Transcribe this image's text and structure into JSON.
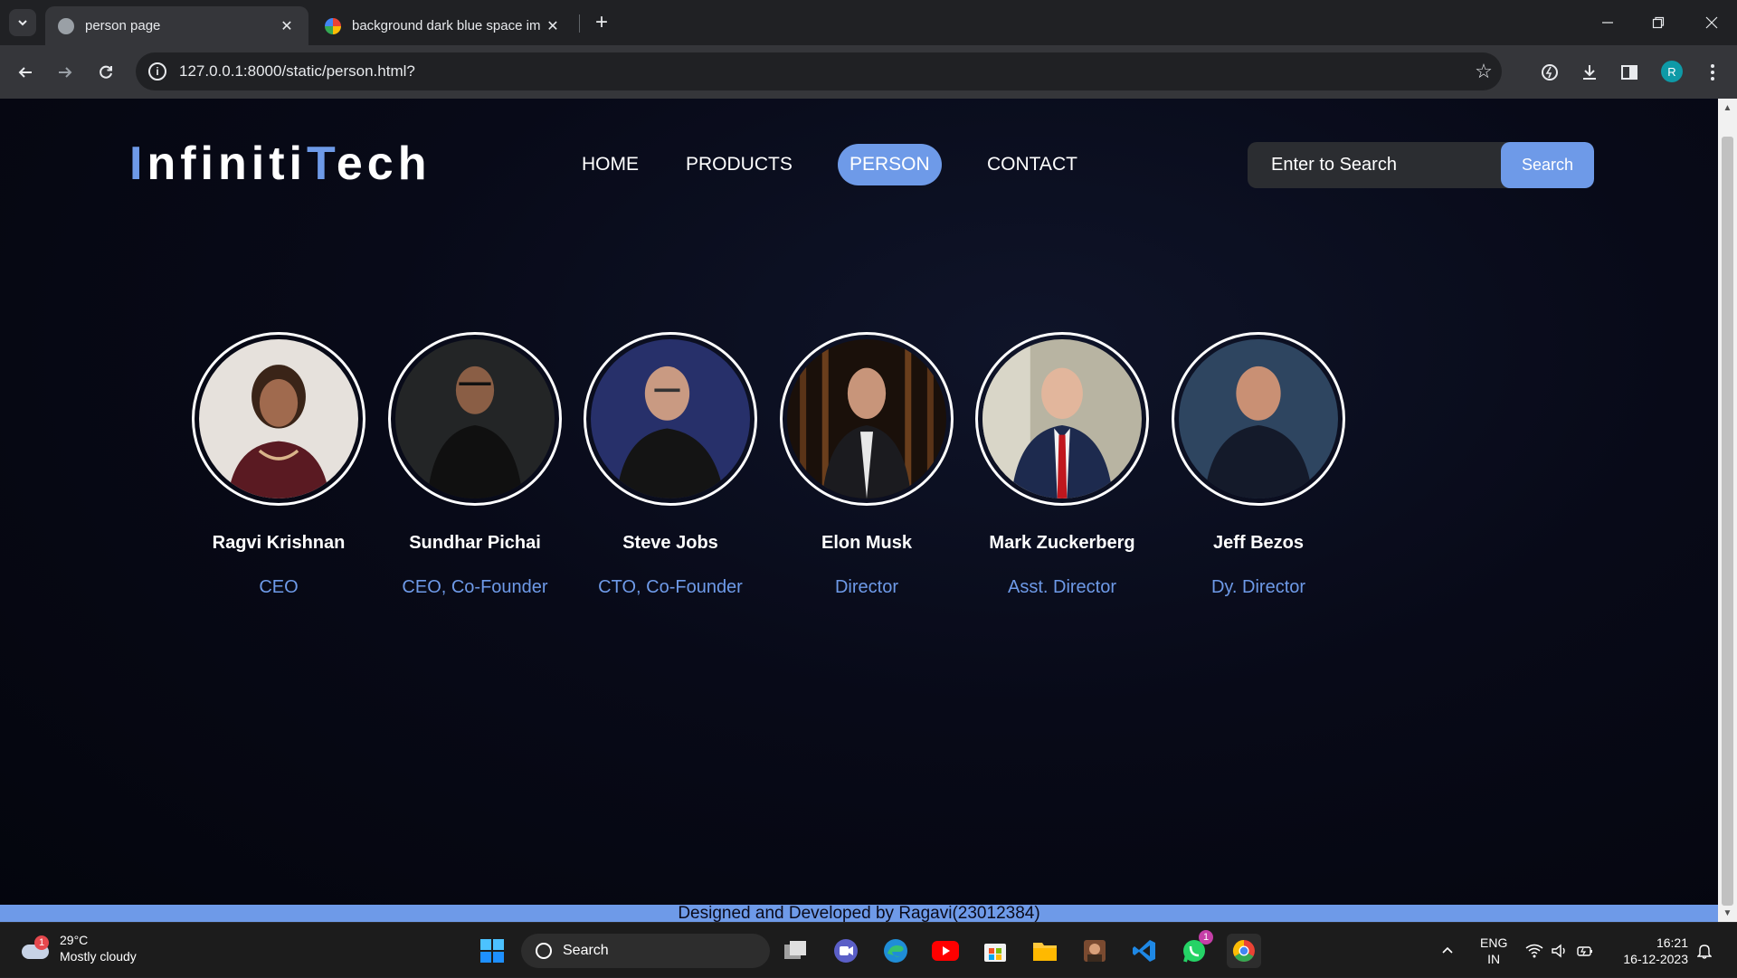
{
  "browser": {
    "tabs": [
      {
        "title": "person page",
        "active": true
      },
      {
        "title": "background dark blue space im",
        "active": false
      }
    ],
    "url": "127.0.0.1:8000/static/person.html?",
    "profile_initial": "R"
  },
  "site": {
    "logo_parts": [
      "I",
      "nfiniti",
      "T",
      "ech"
    ],
    "nav": [
      {
        "label": "HOME",
        "active": false
      },
      {
        "label": "PRODUCTS",
        "active": false
      },
      {
        "label": "PERSON",
        "active": true
      },
      {
        "label": "CONTACT",
        "active": false
      }
    ],
    "search": {
      "placeholder": "Enter to Search",
      "button": "Search"
    },
    "people": [
      {
        "name": "Ragvi Krishnan",
        "role": "CEO"
      },
      {
        "name": "Sundhar Pichai",
        "role": "CEO, Co-Founder"
      },
      {
        "name": "Steve Jobs",
        "role": "CTO, Co-Founder"
      },
      {
        "name": "Elon Musk",
        "role": "Director"
      },
      {
        "name": "Mark Zuckerberg",
        "role": "Asst. Director"
      },
      {
        "name": "Jeff Bezos",
        "role": "Dy. Director"
      }
    ],
    "footer": "Designed and Developed by Ragavi(23012384)",
    "colors": {
      "accent": "#6e9ae8",
      "background": "#080a18"
    }
  },
  "taskbar": {
    "weather": {
      "temp": "29°C",
      "condition": "Mostly cloudy",
      "badge": "1"
    },
    "search_label": "Search",
    "whatsapp_badge": "1",
    "language": {
      "line1": "ENG",
      "line2": "IN"
    },
    "time": "16:21",
    "date": "16-12-2023"
  }
}
